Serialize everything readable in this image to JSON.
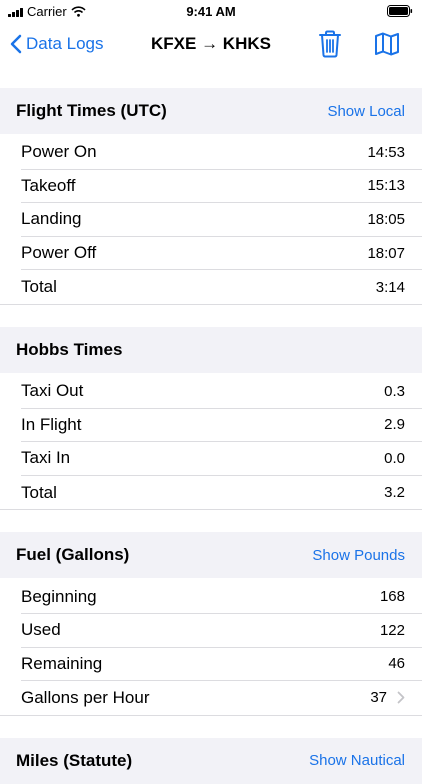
{
  "status_bar": {
    "carrier": "Carrier",
    "time": "9:41 AM"
  },
  "nav": {
    "back_label": "Data Logs",
    "title": "KFXE → KHKS"
  },
  "sections": {
    "flight": {
      "title": "Flight Times (UTC)",
      "action": "Show Local",
      "rows": [
        {
          "label": "Power On",
          "value": "14:53"
        },
        {
          "label": "Takeoff",
          "value": "15:13"
        },
        {
          "label": "Landing",
          "value": "18:05"
        },
        {
          "label": "Power Off",
          "value": "18:07"
        },
        {
          "label": "Total",
          "value": "3:14"
        }
      ]
    },
    "hobbs": {
      "title": "Hobbs Times",
      "rows": [
        {
          "label": "Taxi Out",
          "value": "0.3"
        },
        {
          "label": "In Flight",
          "value": "2.9"
        },
        {
          "label": "Taxi In",
          "value": "0.0"
        },
        {
          "label": "Total",
          "value": "3.2"
        }
      ]
    },
    "fuel": {
      "title": "Fuel (Gallons)",
      "action": "Show Pounds",
      "rows": [
        {
          "label": "Beginning",
          "value": "168"
        },
        {
          "label": "Used",
          "value": "122"
        },
        {
          "label": "Remaining",
          "value": "46"
        },
        {
          "label": "Gallons per Hour",
          "value": "37"
        }
      ]
    },
    "miles": {
      "title": "Miles (Statute)",
      "action": "Show Nautical"
    }
  }
}
